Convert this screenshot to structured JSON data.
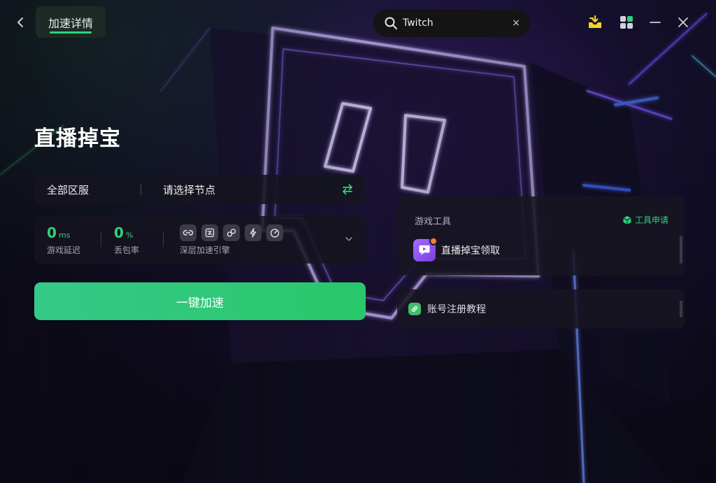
{
  "header": {
    "tab_label": "加速详情",
    "search_value": "Twitch",
    "search_clear": "×"
  },
  "game": {
    "title": "直播掉宝"
  },
  "node_selector": {
    "region": "全部区服",
    "node_placeholder": "请选择节点"
  },
  "stats": {
    "latency_value": "0",
    "latency_unit": "ms",
    "latency_label": "游戏延迟",
    "loss_value": "0",
    "loss_unit": "%",
    "loss_label": "丢包率",
    "engine_label": "深层加速引擎"
  },
  "accelerate_button": "一键加速",
  "tools": {
    "section_label": "游戏工具",
    "apply_label": "工具申请",
    "items": [
      {
        "name": "直播掉宝领取"
      }
    ]
  },
  "guide": {
    "label": "账号注册教程"
  },
  "colors": {
    "accent": "#2fd27a",
    "button_start": "#35c987",
    "button_end": "#29c76a"
  }
}
